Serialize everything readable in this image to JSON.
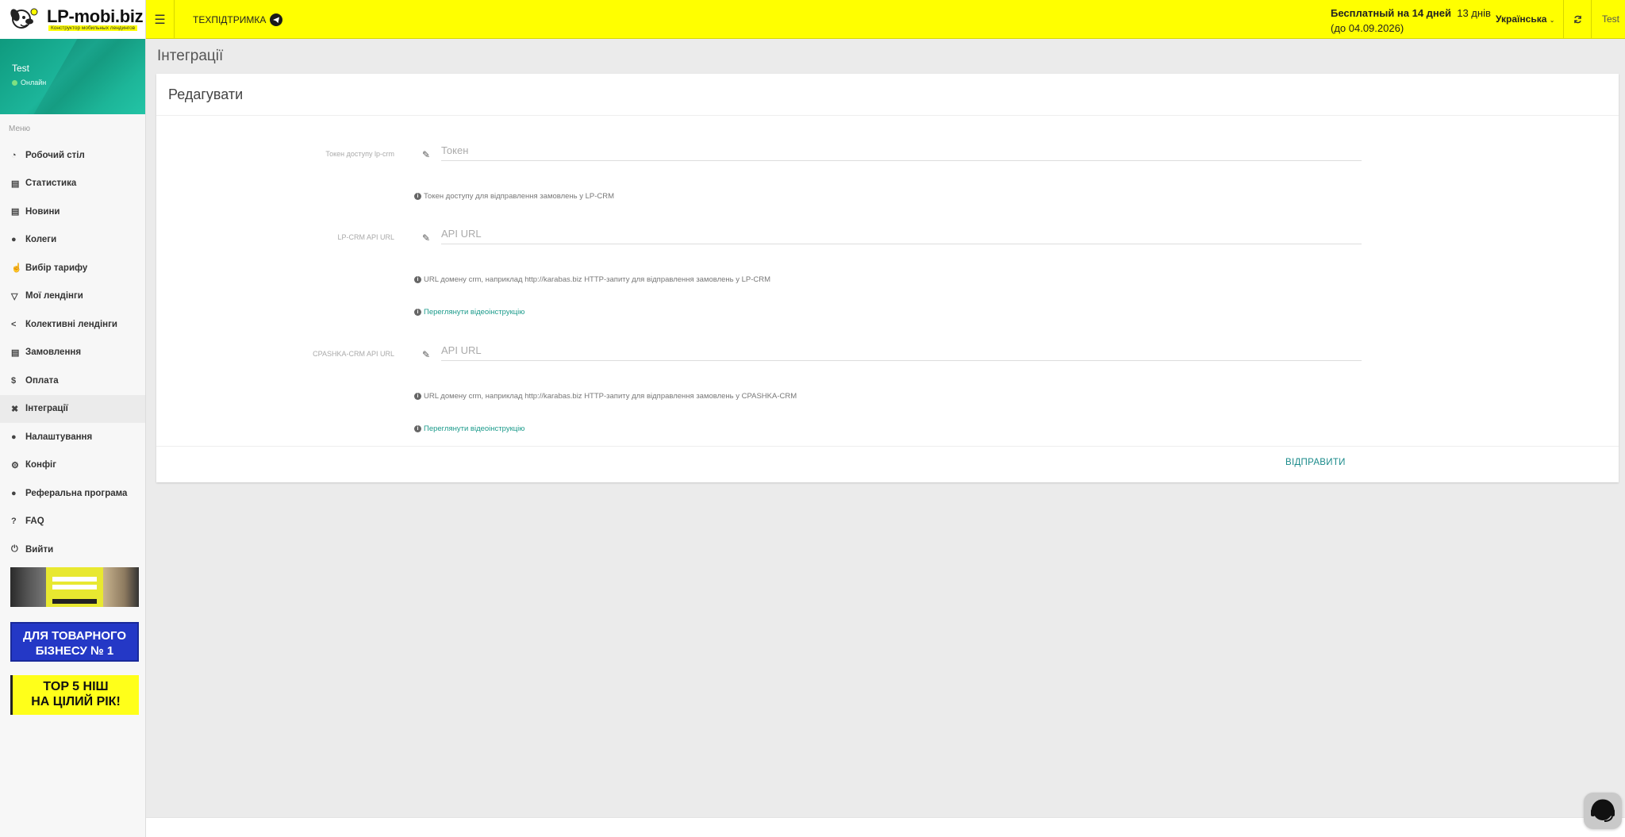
{
  "header": {
    "logo_title": "LP-mobi.biz",
    "logo_subtitle": "Конструктор мобильных лендингов",
    "support_label": "ТЕХПІДТРИМКА",
    "trial_bold": "Бесплатный на 14 дней",
    "trial_days": "13 днів",
    "trial_until": "(до 04.09.2026)",
    "language": "Українська",
    "user": "Test",
    "accent_color": "#ffff00"
  },
  "sidebar": {
    "user_name": "Test",
    "status": "Онлайн",
    "menu_header": "Меню",
    "items": [
      {
        "label": "Робочий стіл",
        "icon": "dashboard-icon"
      },
      {
        "label": "Статистика",
        "icon": "bar-chart-icon"
      },
      {
        "label": "Новини",
        "icon": "newspaper-icon"
      },
      {
        "label": "Колеги",
        "icon": "users-icon"
      },
      {
        "label": "Вибір тарифу",
        "icon": "hand-pointer-icon"
      },
      {
        "label": "Мої лендінги",
        "icon": "flask-icon"
      },
      {
        "label": "Колективні лендінги",
        "icon": "share-icon"
      },
      {
        "label": "Замовлення",
        "icon": "cart-icon"
      },
      {
        "label": "Оплата",
        "icon": "dollar-icon"
      },
      {
        "label": "Інтеграції",
        "icon": "plug-icon",
        "active": true
      },
      {
        "label": "Налаштування",
        "icon": "user-icon"
      },
      {
        "label": "Конфіг",
        "icon": "cogs-icon"
      },
      {
        "label": "Реферальна програма",
        "icon": "user-plus-icon"
      },
      {
        "label": "FAQ",
        "icon": "question-icon"
      },
      {
        "label": "Вийти",
        "icon": "power-icon"
      }
    ],
    "banner2_line1": "ДЛЯ ТОВАРНОГО",
    "banner2_line2": "БІЗНЕСУ  № 1",
    "banner3_line1": "TOP 5 НІШ",
    "banner3_line2": "НА ЦІЛИЙ РІК!"
  },
  "main": {
    "page_title": "Інтеграції",
    "card_title": "Редагувати",
    "fields": [
      {
        "label": "Токен доступу lp-crm",
        "placeholder": "Токен",
        "value": "",
        "hint": "Токен доступу для відправлення замовлень у LP-CRM"
      },
      {
        "label": "LP-CRM API URL",
        "placeholder": "API URL",
        "value": "",
        "hint": "URL домену crm, наприклад http://karabas.biz HTTP-запиту для відправлення замовлень у LP-CRM",
        "link": "Переглянути відеоінструкцію"
      },
      {
        "label": "CPASHKA-CRM API URL",
        "placeholder": "API URL",
        "value": "",
        "hint": "URL домену crm, наприклад http://karabas.biz HTTP-запиту для відправлення замовлень у CPASHKA-CRM",
        "link": "Переглянути відеоінструкцію"
      }
    ],
    "submit_label": "ВІДПРАВИТИ"
  }
}
